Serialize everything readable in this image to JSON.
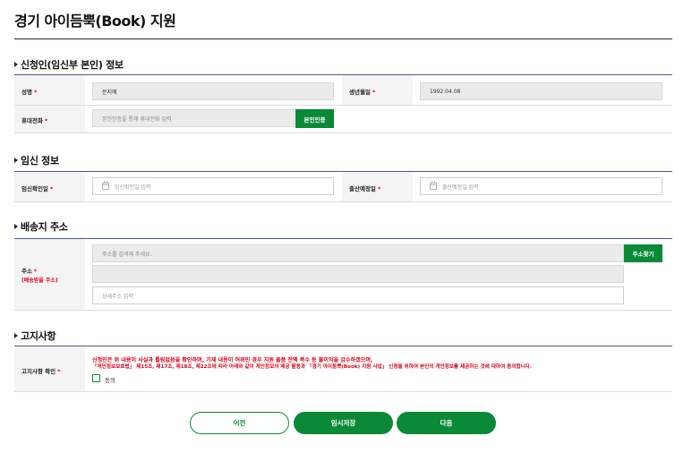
{
  "page_title": "경기 아이듬뿍(Book) 지원",
  "sections": {
    "applicant": {
      "title": "신청인(임신부 본인) 정보",
      "name_label": "성명",
      "name_value": "문지예",
      "birth_label": "생년월일",
      "birth_value": "1992.04.08",
      "phone_label": "휴대전화",
      "phone_placeholder": "본인인증을 통해 휴대전화 입력",
      "verify_button": "본인인증"
    },
    "pregnancy": {
      "title": "임신 정보",
      "confirm_date_label": "임신확인일",
      "confirm_date_placeholder": "임신확인일 입력",
      "due_date_label": "출산예정일",
      "due_date_placeholder": "출산예정일 입력"
    },
    "shipping": {
      "title": "배송지 주소",
      "address_label": "주소",
      "address_sublabel": "(배송받을 주소)",
      "address_search_placeholder": "주소를 검색해 주세요.",
      "address_search_button": "주소찾기",
      "address_line2_value": "",
      "address_detail_placeholder": "상세주소 입력"
    },
    "notice": {
      "title": "고지사항",
      "confirm_label": "고지사항 확인",
      "text_line1": "신청인은 위 내용이 사실과 틀림없음을 확인하며, 기재 내용이 허위인 경우 지원 물품 전액 폭수 등 불이익을 감수하겠으며,",
      "text_line2": "「개인정보보호법」 제15조, 제17조, 제18조, 제22조에 따라 아래와 같이 개인정보의 제공 활용과 「경기 아이듬뿍(Book) 지원 사업」 신청을 위하여 본인의 개인정보를 제공하는 것에 대하여 동의합니다.",
      "agree_label": "동의",
      "agree_checked": false
    }
  },
  "required_mark": "*",
  "buttons": {
    "prev": "이전",
    "save": "임시저장",
    "next": "다음"
  },
  "colors": {
    "accent_green": "#0a8a36",
    "required_red": "#e0001a",
    "heading_navy": "#1e2a4a"
  },
  "icons": {
    "calendar": "calendar-icon",
    "section_bullet": "triangle-bullet-icon"
  }
}
